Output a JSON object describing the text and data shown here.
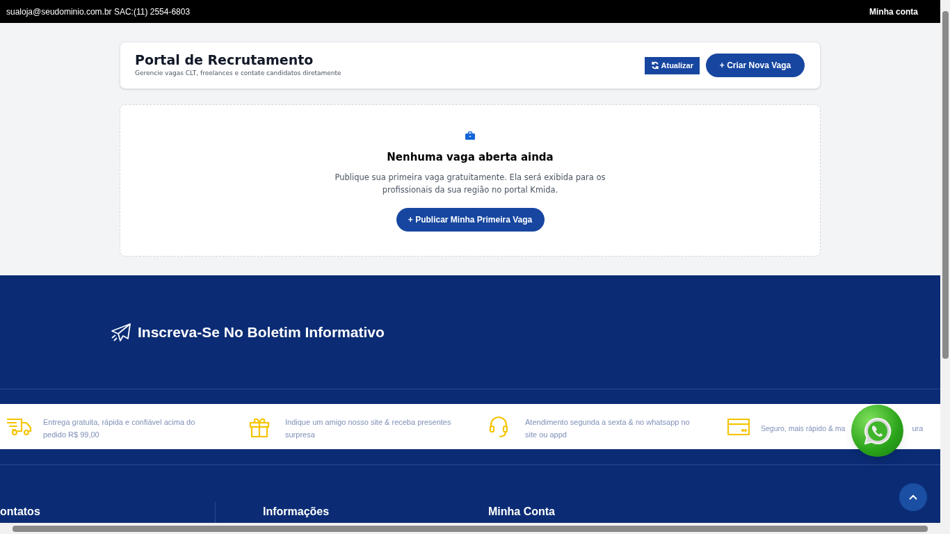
{
  "top_bar": {
    "contact": "sualoja@seudominio.com.br SAC:(11) 2554-6803",
    "account_link": "Minha conta"
  },
  "header": {
    "title": "Portal de Recrutamento",
    "subtitle": "Gerencie vagas CLT, freelances e contate candidatos diretamente",
    "buttons": [
      {
        "kind": "refresh",
        "label": "Atualizar"
      },
      {
        "kind": "primary",
        "label": "+ Criar Nova Vaga"
      }
    ]
  },
  "empty_state": {
    "title": "Nenhuma vaga aberta ainda",
    "message": "Publique sua primeira vaga gratuitamente. Ela será exibida para os profissionais da sua região no portal Kmida.",
    "button": "+ Publicar Minha Primeira Vaga"
  },
  "newsletter": {
    "title": "Inscreva-Se No Boletim Informativo"
  },
  "features": [
    {
      "kind": "truck",
      "text": "Entrega gratuita, rápida e confiável acima do pedido R$ 99,00"
    },
    {
      "kind": "gift",
      "text": "Indique um amigo nosso site & receba presentes surpresa"
    },
    {
      "kind": "headset",
      "text": "Atendimento segunda a sexta & no whatsapp no site ou appd"
    },
    {
      "kind": "card",
      "text": "Seguro, mais rápido & ma",
      "text_after": "ura"
    }
  ],
  "footer_columns": [
    "ontatos",
    "Informações",
    "Minha Conta"
  ]
}
